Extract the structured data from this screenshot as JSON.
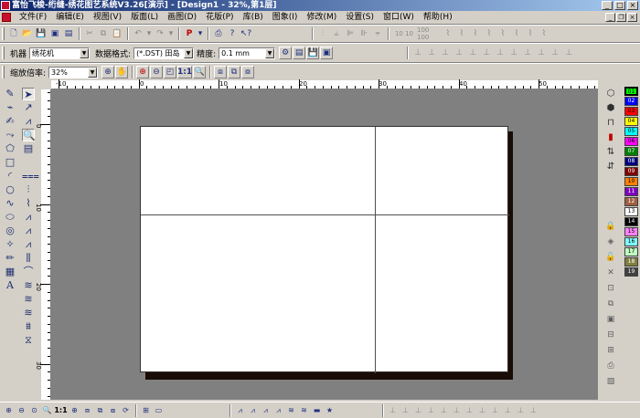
{
  "titlebar": {
    "title": "富怡飞梭-绗缝-绣花图艺系统V3.26[演示] - [Design1 - 32%,第1层]"
  },
  "menubar": {
    "items": [
      "文件(F)",
      "编辑(E)",
      "视图(V)",
      "版面(L)",
      "画图(D)",
      "花版(P)",
      "库(B)",
      "图象(I)",
      "修改(M)",
      "设置(S)",
      "窗口(W)",
      "帮助(H)"
    ]
  },
  "toolbar2": {
    "machine_label": "机器",
    "machine_value": "绣花机",
    "format_label": "数据格式:",
    "format_value": "(*.DST) 田岛",
    "precision_label": "精度:",
    "precision_value": "0.1 mm"
  },
  "toolbar3": {
    "zoom_label": "缩放倍率:",
    "zoom_value": "32%",
    "one_to_one": "1:1"
  },
  "rulers": {
    "h_labels": [
      "-10",
      "0",
      "10",
      "20",
      "30",
      "40",
      "50"
    ],
    "v_labels": [
      "0",
      "10",
      "20",
      "30"
    ]
  },
  "palette": {
    "colors": [
      {
        "num": "01",
        "color": "#00ff00"
      },
      {
        "num": "02",
        "color": "#0000ff"
      },
      {
        "num": "03",
        "color": "#ff0000"
      },
      {
        "num": "04",
        "color": "#ffff00"
      },
      {
        "num": "05",
        "color": "#00ffff"
      },
      {
        "num": "06",
        "color": "#ff00ff"
      },
      {
        "num": "07",
        "color": "#008000"
      },
      {
        "num": "08",
        "color": "#000080"
      },
      {
        "num": "09",
        "color": "#800000"
      },
      {
        "num": "10",
        "color": "#ff8000"
      },
      {
        "num": "11",
        "color": "#8000c0"
      },
      {
        "num": "12",
        "color": "#a06040"
      },
      {
        "num": "13",
        "color": "#ffffff"
      },
      {
        "num": "14",
        "color": "#000000"
      },
      {
        "num": "15",
        "color": "#ff80ff"
      },
      {
        "num": "16",
        "color": "#80ffff"
      },
      {
        "num": "17",
        "color": "#c0ffc0"
      },
      {
        "num": "18",
        "color": "#808040"
      },
      {
        "num": "19",
        "color": "#404040"
      }
    ]
  },
  "bottombar": {
    "one_to_one": "1:1"
  }
}
